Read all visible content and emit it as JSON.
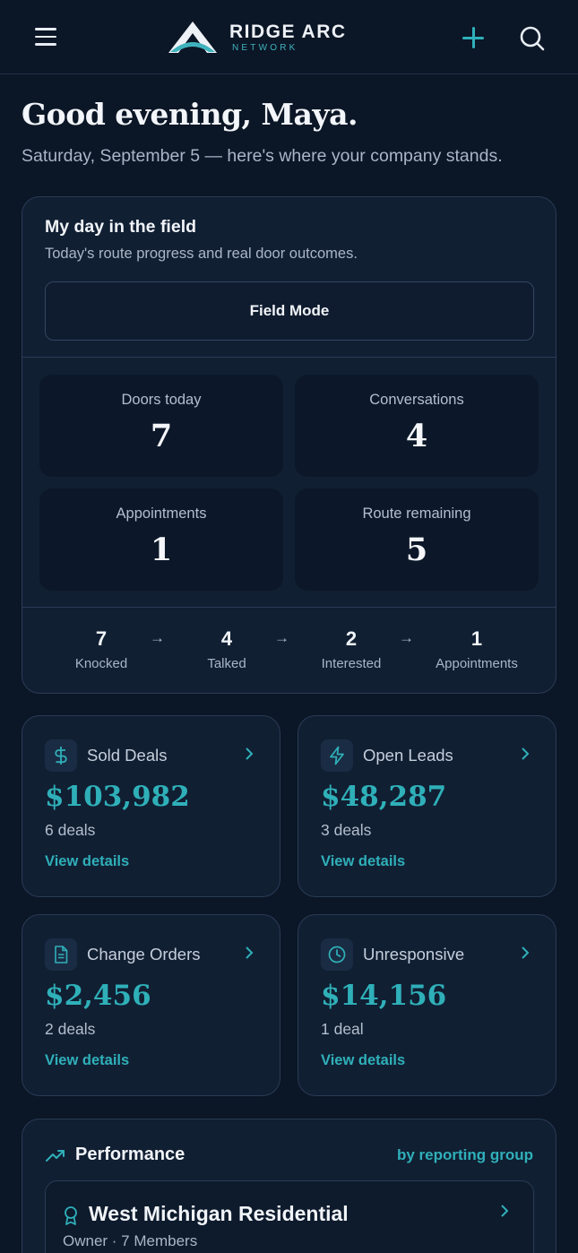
{
  "header": {
    "brand_name": "RIDGE ARC",
    "brand_sub": "NETWORK",
    "icons": {
      "menu": "hamburger-icon",
      "add": "plus-icon",
      "search": "search-icon"
    },
    "accent_color": "#2fb0b9"
  },
  "greeting": {
    "title": "Good evening, Maya.",
    "subtitle": "Saturday, September 5 — here's where your company stands."
  },
  "field": {
    "title": "My day in the field",
    "subtitle": "Today's route progress and real door outcomes.",
    "button_label": "Field Mode",
    "stats": [
      {
        "label": "Doors today",
        "value": "7"
      },
      {
        "label": "Conversations",
        "value": "4"
      },
      {
        "label": "Appointments",
        "value": "1"
      },
      {
        "label": "Route remaining",
        "value": "5"
      }
    ],
    "funnel": [
      {
        "value": "7",
        "label": "Knocked"
      },
      {
        "value": "4",
        "label": "Talked"
      },
      {
        "value": "2",
        "label": "Interested"
      },
      {
        "value": "1",
        "label": "Appointments"
      }
    ],
    "arrow": "→"
  },
  "kpis": [
    {
      "icon": "dollar-icon",
      "label": "Sold Deals",
      "value": "$103,982",
      "count": "6 deals",
      "link": "View details"
    },
    {
      "icon": "lightning-icon",
      "label": "Open Leads",
      "value": "$48,287",
      "count": "3 deals",
      "link": "View details"
    },
    {
      "icon": "document-icon",
      "label": "Change Orders",
      "value": "$2,456",
      "count": "2 deals",
      "link": "View details"
    },
    {
      "icon": "clock-icon",
      "label": "Unresponsive",
      "value": "$14,156",
      "count": "1 deal",
      "link": "View details"
    }
  ],
  "performance": {
    "title": "Performance",
    "link": "by reporting group",
    "group": {
      "name": "West Michigan Residential",
      "meta": "Owner · 7 Members"
    }
  }
}
